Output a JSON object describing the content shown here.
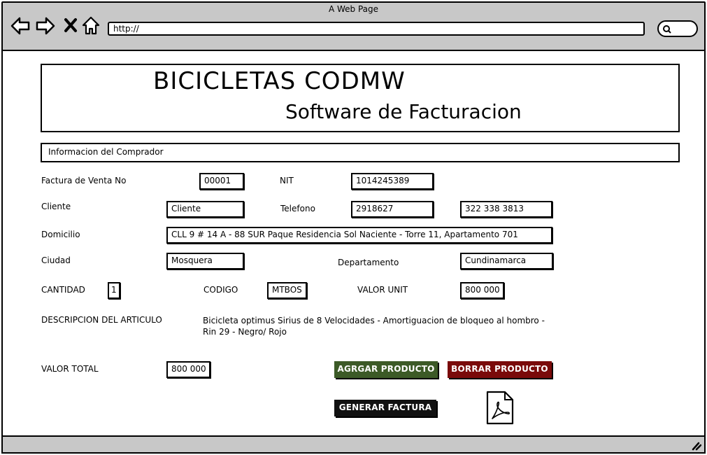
{
  "browser": {
    "title": "A Web Page",
    "url": "http://"
  },
  "header": {
    "brand": "BICICLETAS CODMW",
    "subtitle": "Software de Facturacion"
  },
  "section": {
    "title": "Informacion del Comprador"
  },
  "form": {
    "invoice_label": "Factura de Venta No",
    "invoice_value": "00001",
    "nit_label": "NIT",
    "nit_value": "1014245389",
    "client_label": "Cliente",
    "client_value": "Cliente",
    "phone_label": "Telefono",
    "phone_value": "2918627",
    "mobile_value": "322 338 3813",
    "address_label": "Domicilio",
    "address_value": "CLL 9 # 14 A - 88 SUR Paque Residencia Sol Naciente - Torre 11, Apartamento 701",
    "city_label": "Ciudad",
    "city_value": "Mosquera",
    "department_label": "Departamento",
    "department_value": "Cundinamarca",
    "quantity_label": "CANTIDAD",
    "quantity_value": "1",
    "code_label": "CODIGO",
    "code_value": "MTBOS",
    "unit_price_label": "VALOR UNIT",
    "unit_price_value": "800 000",
    "description_label": "DESCRIPCION DEL ARTICULO",
    "description_value": "Bicicleta optimus Sirius de 8 Velocidades - Amortiguacion de bloqueo al hombro - Rin 29 - Negro/ Rojo",
    "total_label": "VALOR TOTAL",
    "total_value": "800 000"
  },
  "buttons": {
    "add": "AGRGAR PRODUCTO",
    "delete": "BORRAR PRODUCTO",
    "generate": "GENERAR FACTURA"
  },
  "icons": {
    "back": "back-arrow-icon",
    "forward": "forward-arrow-icon",
    "stop": "close-icon",
    "home": "home-icon",
    "search": "search-icon",
    "pdf": "pdf-icon",
    "resize": "resize-grip-icon"
  },
  "colors": {
    "add_button": "#3c5a27",
    "delete_button": "#7a0a0a",
    "generate_button": "#111111",
    "chrome": "#c8c8c8"
  }
}
